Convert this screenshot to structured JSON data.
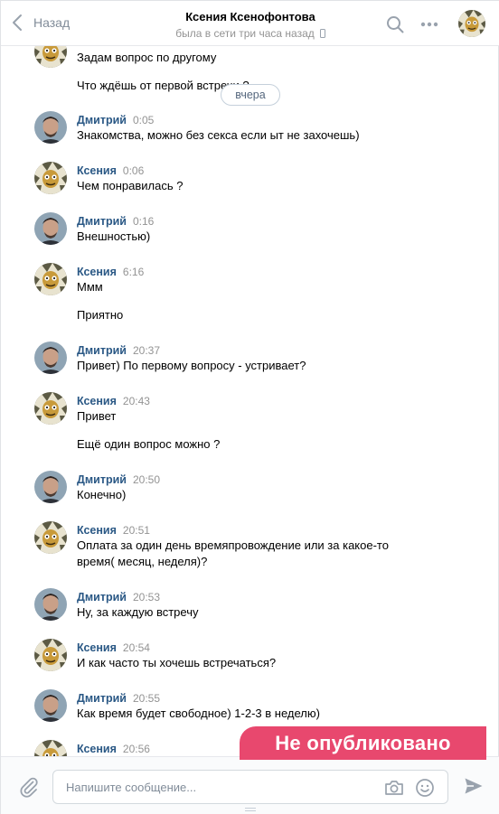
{
  "header": {
    "back_label": "Назад",
    "title": "Ксения Ксенофонтова",
    "subtitle": "была в сети три часа назад"
  },
  "date_separator": "вчера",
  "messages": [
    {
      "author": "",
      "time": "",
      "person": "k",
      "lines": [
        "Задам вопрос по другому",
        "Что ждёшь от первой встречи ?"
      ]
    },
    {
      "author": "Дмитрий",
      "time": "0:05",
      "person": "d",
      "lines": [
        "Знакомства, можно без секса если ыт не захочешь)"
      ]
    },
    {
      "author": "Ксения",
      "time": "0:06",
      "person": "k",
      "lines": [
        "Чем понравилась ?"
      ]
    },
    {
      "author": "Дмитрий",
      "time": "0:16",
      "person": "d",
      "lines": [
        "Внешностью)"
      ]
    },
    {
      "author": "Ксения",
      "time": "6:16",
      "person": "k",
      "lines": [
        "Ммм",
        "Приятно"
      ]
    },
    {
      "author": "Дмитрий",
      "time": "20:37",
      "person": "d",
      "lines": [
        "Привет) По первому вопросу - устривает?"
      ]
    },
    {
      "author": "Ксения",
      "time": "20:43",
      "person": "k",
      "lines": [
        "Привет",
        "Ещё один вопрос можно ?"
      ]
    },
    {
      "author": "Дмитрий",
      "time": "20:50",
      "person": "d",
      "lines": [
        "Конечно)"
      ]
    },
    {
      "author": "Ксения",
      "time": "20:51",
      "person": "k",
      "lines": [
        "Оплата за один день времяпровождение или за какое-то время( месяц, неделя)?"
      ]
    },
    {
      "author": "Дмитрий",
      "time": "20:53",
      "person": "d",
      "lines": [
        "Ну, за каждую встречу"
      ]
    },
    {
      "author": "Ксения",
      "time": "20:54",
      "person": "k",
      "lines": [
        "И как часто ты хочешь встречаться?"
      ]
    },
    {
      "author": "Дмитрий",
      "time": "20:55",
      "person": "d",
      "lines": [
        "Как время будет свободное) 1-2-3 в неделю)"
      ]
    },
    {
      "author": "Ксения",
      "time": "20:56",
      "person": "k",
      "lines": []
    }
  ],
  "composer": {
    "placeholder": "Напишите сообщение..."
  },
  "stamp_text": "Не опубликовано",
  "colors": {
    "author_link": "#2a5885",
    "stamp": "#e8486e",
    "meta_gray": "#939393"
  },
  "icons": [
    "back-chevron-icon",
    "phone-icon",
    "search-icon",
    "more-icon",
    "paperclip-icon",
    "camera-icon",
    "smile-icon",
    "send-icon"
  ]
}
